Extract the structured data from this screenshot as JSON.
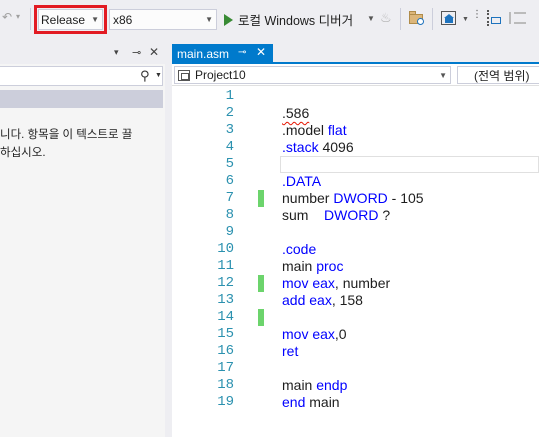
{
  "toolbar": {
    "undo_icon": "undo-icon",
    "configuration": "Release",
    "platform": "x86",
    "run_label": "로컬 Windows 디버거",
    "colors": {
      "highlight_border": "#e21b23",
      "run_green": "#388a34"
    }
  },
  "left_panel": {
    "message_line1": "니다. 항목을 이 텍스트로 끌",
    "message_line2": "하십시오."
  },
  "editor": {
    "tab_label": "main.asm",
    "tab_pin": "⊸",
    "tab_close": "✕",
    "accent": "#007acc",
    "project": "Project10",
    "scope": "(전역 범위)",
    "lines": [
      {
        "num": "1",
        "code": ""
      },
      {
        "num": "2",
        "code": ".586"
      },
      {
        "num": "3",
        "code_a": ".model ",
        "code_kw": "flat"
      },
      {
        "num": "4",
        "code_kw": ".stack",
        "code_b": " 4096"
      },
      {
        "num": "5",
        "code": ""
      },
      {
        "num": "6",
        "code_kw": ".DATA"
      },
      {
        "num": "7",
        "code_a": "number ",
        "code_kw": "DWORD",
        "code_b": " - 105"
      },
      {
        "num": "8",
        "code_a": "sum    ",
        "code_kw": "DWORD",
        "code_b": " ?"
      },
      {
        "num": "9",
        "code": ""
      },
      {
        "num": "10",
        "code_kw": ".code"
      },
      {
        "num": "11",
        "code_a": "main ",
        "code_kw": "proc"
      },
      {
        "num": "12",
        "code_kw": "mov eax",
        "code_b": ", number"
      },
      {
        "num": "13",
        "code_kw": "add eax",
        "code_b": ", 158"
      },
      {
        "num": "14",
        "code": ""
      },
      {
        "num": "15",
        "code_kw": "mov eax",
        "code_b": ",0"
      },
      {
        "num": "16",
        "code_kw": "ret"
      },
      {
        "num": "17",
        "code": ""
      },
      {
        "num": "18",
        "code_a": "main ",
        "code_kw": "endp"
      },
      {
        "num": "19",
        "code_kw": "end",
        "code_b": " main"
      }
    ]
  }
}
